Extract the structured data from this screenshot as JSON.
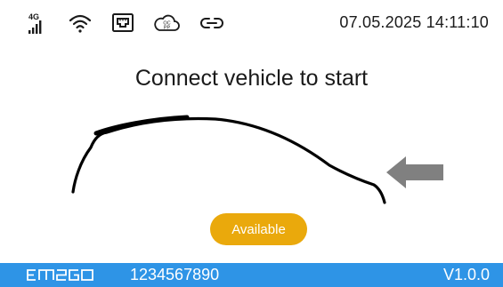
{
  "status_bar": {
    "cellular_label": "4G",
    "ocpp_label_top": "OC",
    "ocpp_label_bottom": "PP",
    "datetime": "07.05.2025 14:11:10",
    "icons": [
      "cellular-4g-icon",
      "wifi-icon",
      "ethernet-icon",
      "ocpp-cloud-icon",
      "link-icon"
    ]
  },
  "main": {
    "headline": "Connect vehicle to start",
    "status": "Available",
    "illustration_icons": [
      "car-outline-icon",
      "arrow-left-icon"
    ]
  },
  "footer": {
    "logo_text": "EM2GO",
    "serial_number": "1234567890",
    "version": "V1.0.0"
  },
  "colors": {
    "status_available": "#EAA90C",
    "footer_background": "#2E94E6",
    "arrow": "#808080",
    "text": "#1A1A1A",
    "background": "#FFFFFF"
  }
}
